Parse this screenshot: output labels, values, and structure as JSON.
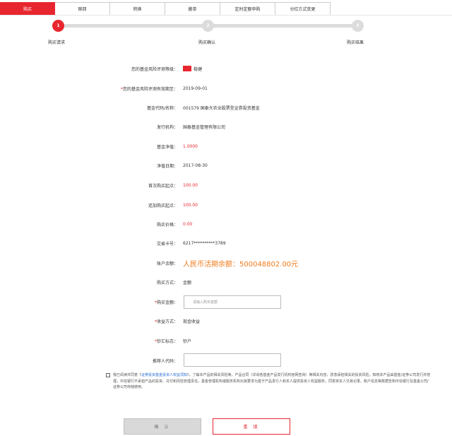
{
  "tabs": [
    {
      "label": "购买"
    },
    {
      "label": "赎回"
    },
    {
      "label": "转换"
    },
    {
      "label": "撤单"
    },
    {
      "label": "定时定额申购"
    },
    {
      "label": "分红方式变更"
    }
  ],
  "steps": [
    {
      "number": "1",
      "label": "购买请求"
    },
    {
      "number": "2",
      "label": "购买确认"
    },
    {
      "number": "3",
      "label": "购买结果"
    }
  ],
  "form": {
    "risk_level_label": "您的基金风险评测等级：",
    "risk_level_value": "稳健",
    "risk_expiry_label": "您的基金风险评测有效期至：",
    "risk_expiry_value": "2019-09-01",
    "fund_code_label": "基金代码/名称：",
    "fund_code_value": "001579 国泰大农业股票型证券投资基金",
    "issuer_label": "发行机构：",
    "issuer_value": "国泰基金管理有限公司",
    "nav_label": "基金净值：",
    "nav_value": "1.0000",
    "nav_date_label": "净值日期：",
    "nav_date_value": "2017-08-30",
    "first_min_label": "首次购买起点：",
    "first_min_value": "100.00",
    "add_min_label": "追加购买起点：",
    "add_min_value": "100.00",
    "price_label": "购买价格：",
    "price_value": "0.00",
    "card_label": "交易卡号：",
    "card_value": "6217**********3789",
    "balance_label": "账户余额：",
    "balance_value": "人民币活期余额：500048802.00元",
    "method_label": "购买方式：",
    "method_value": "金额",
    "amount_label": "购买金额：",
    "amount_placeholder": "请输入购买金额",
    "dividend_label": "收益方式：",
    "dividend_value": "现金收益",
    "cash_label": "钞汇标志：",
    "cash_value": "钞户",
    "referrer_label": "推荐人代码："
  },
  "agreement": {
    "prefix": "我已阅读并同意《",
    "link": "证券投资基金投资人权益须知",
    "suffix": "》，了解本产品的相关风险等，产品合同（详询各基金产品发行机构官网查询）等相关内容，愿意承担相关的投资风险，知晓本产品由基金/证券公司发行并管理，中信银行不承担产品的投资、兑付和风险管理责任，基金管理机构或服务机构对其要求为基于产品发行人和本人提供投资人权益服务，同意将本人交易记录、账户信息等数据告知中信银行及基金公司/证券公司存储使用。"
  },
  "buttons": {
    "confirm": "确 认",
    "reset": "重 填"
  },
  "colors": {
    "accent": "#e8262f",
    "balance": "#f07b1c",
    "link": "#2a6fd6"
  }
}
